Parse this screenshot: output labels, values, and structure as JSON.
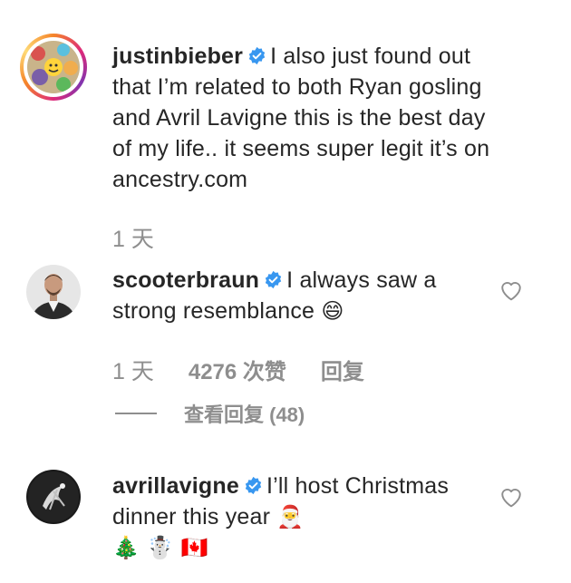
{
  "comments": [
    {
      "username": "justinbieber",
      "text": "I also just found out that I’m related to both Ryan gosling and Avril Lavigne this is the best day of my life.. it seems super legit it’s on ancestry.com",
      "time": "1 天"
    },
    {
      "username": "scooterbraun",
      "text": "I always saw a strong resemblance",
      "emoji": "😄",
      "time": "1 天",
      "likes": "4276 次赞",
      "reply_label": "回复",
      "view_replies": "查看回复 (48)"
    },
    {
      "username": "avrillavigne",
      "text": "I’ll host Christmas dinner this year",
      "emoji_line1": "🎅",
      "emoji_line2": "🎄 ☃️ 🇨🇦"
    }
  ],
  "colors": {
    "verified": "#3897f0",
    "meta": "#8e8e8e",
    "text": "#262626"
  },
  "icons": [
    "verified-badge-icon",
    "heart-icon"
  ]
}
